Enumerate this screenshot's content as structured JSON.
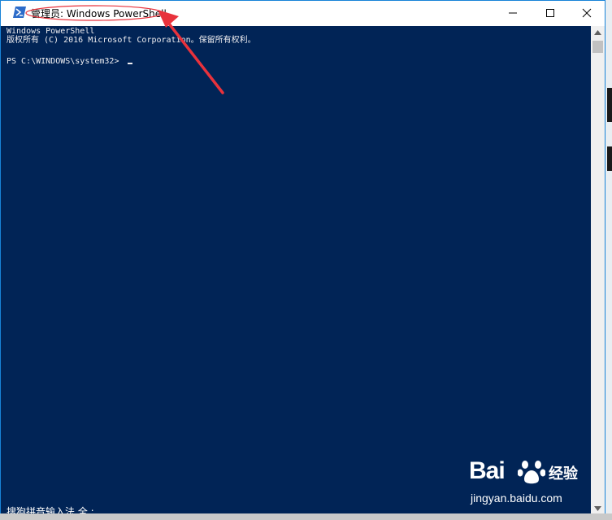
{
  "window": {
    "title": "管理员: Windows PowerShell",
    "icon": "powershell-icon",
    "controls": [
      "minimize-icon",
      "maximize-icon",
      "close-icon"
    ]
  },
  "console": {
    "lines": [
      "Windows PowerShell",
      "版权所有 (C) 2016 Microsoft Corporation。保留所有权利。",
      "PS C:\\WINDOWS\\system32> "
    ],
    "ime_status": "搜狗拼音输入法 全 :"
  },
  "watermark": {
    "logo": "Bai",
    "jingyan": "经验",
    "url": "jingyan.baidu.com"
  },
  "colors": {
    "console_bg": "#012456",
    "annotation": "#e8323c"
  }
}
